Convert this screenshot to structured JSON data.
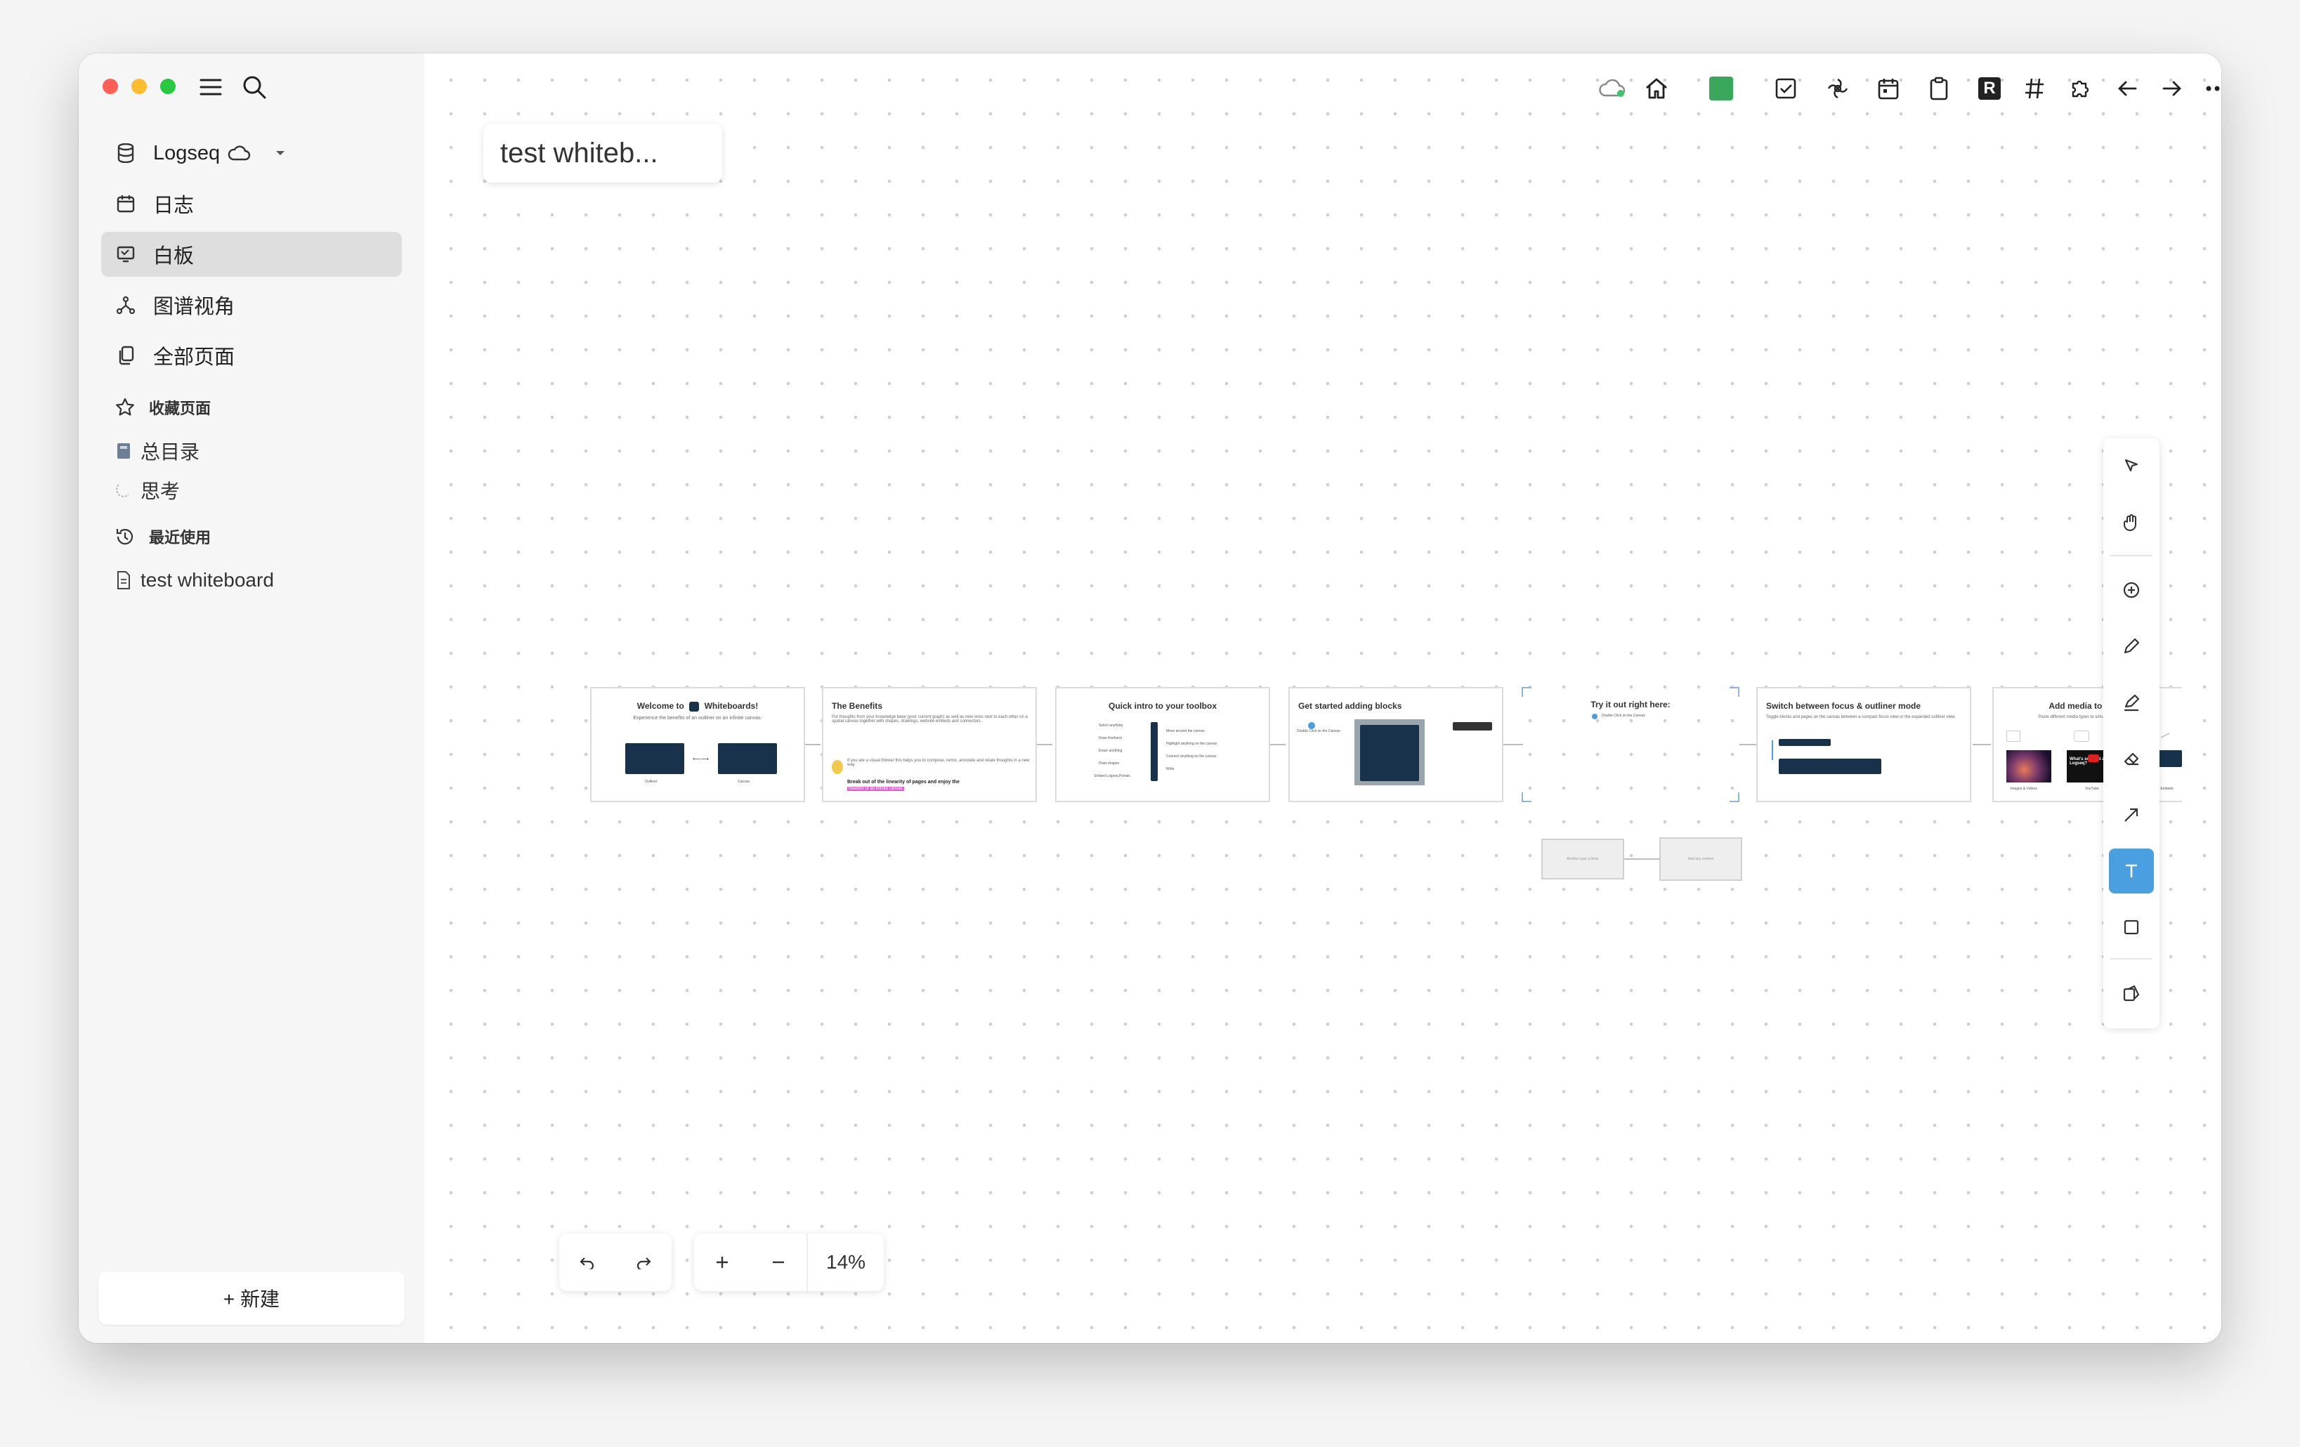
{
  "sidebar": {
    "graph_name": "Logseq",
    "nav": [
      {
        "label": "日志",
        "icon": "calendar-icon"
      },
      {
        "label": "白板",
        "icon": "whiteboard-icon",
        "active": true
      },
      {
        "label": "图谱视角",
        "icon": "graph-icon"
      },
      {
        "label": "全部页面",
        "icon": "pages-icon"
      }
    ],
    "favorites_heading": "收藏页面",
    "favorites": [
      "总目录",
      "思考"
    ],
    "recent_heading": "最近使用",
    "recent": [
      "test whiteboard"
    ],
    "new_button": "+ 新建"
  },
  "canvas": {
    "title": "test whiteb...",
    "zoom": "14%",
    "cards": [
      {
        "title": "Welcome to",
        "title2": "Whiteboards!",
        "sub": "Experience the benefits of an outliner on an infinite canvas.",
        "labels": [
          "Outliner",
          "Canvas"
        ]
      },
      {
        "title": "The Benefits",
        "sub": "Put thoughts from your knowledge base (your current graph) as well as new ones next to each other on a spatial canvas together with shapes, drawings, website embeds and connectors.",
        "sub2": "If you are a visual thinker this helps you to compose, remix, annotate and relate thoughts in a new way.",
        "highlight": "Break out of the linearity of pages and enjoy the",
        "highlight2": "freedom of an infinite canvas"
      },
      {
        "title": "Quick intro to your toolbox",
        "rows": [
          "Select anything",
          "Move around the canvas",
          "Draw freehand",
          "Highlight anything on the canvas",
          "Erase anything",
          "Connect anything on the canvas",
          "Draw shapes",
          "Write",
          "Embed Logseq Portals"
        ]
      },
      {
        "title": "Get started adding blocks",
        "sub": "Double Click on the Canvas"
      },
      {
        "title": "Try it out right here:",
        "sub": "Double Click on the Canvas"
      },
      {
        "title": "Switch between focus & outliner mode",
        "sub": "Toggle blocks and pages on the canvas between a compact focus view or the expanded outliner view."
      },
      {
        "title": "Add media to the canvas",
        "sub": "Paste different media types to simulate your thoughts",
        "labels": [
          "Images & Videos",
          "YouTube",
          "Website Embeds"
        ],
        "yt_text": "What's so great about Logseq?"
      }
    ],
    "small_boxes": [
      "Another type a block",
      "Add any content"
    ]
  },
  "colors": {
    "accent": "#4a9fe0",
    "sidebar_active": "#dedede",
    "dark_card": "#17324a",
    "highlight": "#e65ad1"
  }
}
